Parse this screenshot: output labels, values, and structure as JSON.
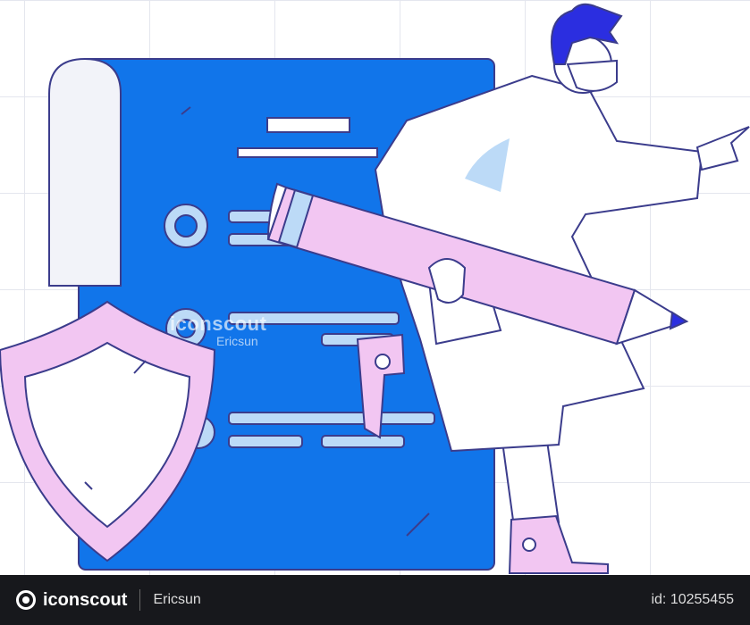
{
  "watermark": {
    "brand": "iconscout",
    "author": "Ericsun"
  },
  "footer": {
    "brand": "iconscout",
    "author": "Ericsun",
    "asset_id": "id: 10255455"
  },
  "colors": {
    "document": "#1175ea",
    "outline": "#3b3c8c",
    "pink": "#f2c6f2",
    "light_blue": "#bcdaf7",
    "navy_hair": "#2b2ee0",
    "coat": "#ffffff"
  },
  "icons": [
    "document-icon",
    "shield-icon",
    "pencil-icon",
    "doctor-figure"
  ]
}
